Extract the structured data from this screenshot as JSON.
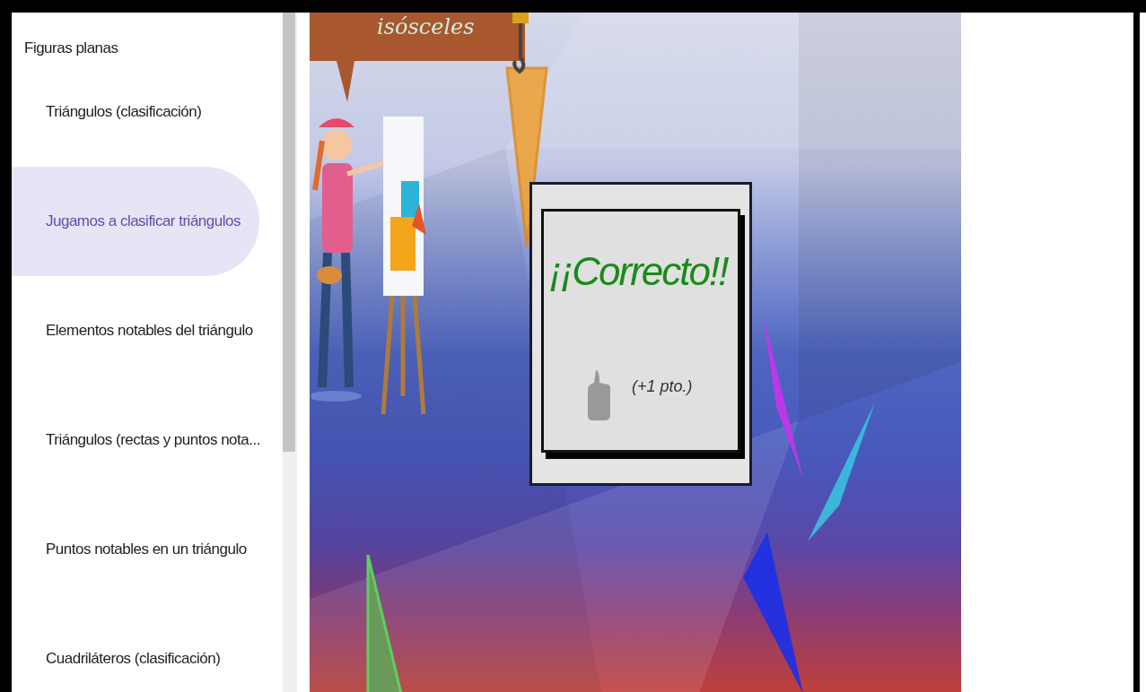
{
  "sidebar": {
    "heading": "Figuras planas",
    "items": [
      {
        "label": "Triángulos (clasificación)",
        "selected": false
      },
      {
        "label": "Jugamos a clasificar triángulos",
        "selected": true
      },
      {
        "label": "Elementos notables del triángulo",
        "selected": false
      },
      {
        "label": "Triángulos (rectas y puntos nota...",
        "selected": false
      },
      {
        "label": "Puntos notables en un triángulo",
        "selected": false
      },
      {
        "label": "Cuadriláteros (clasificación)",
        "selected": false
      }
    ]
  },
  "game": {
    "banner_text": "isósceles",
    "message": "¡¡Correcto!!",
    "points": "(+1 pto.)"
  }
}
